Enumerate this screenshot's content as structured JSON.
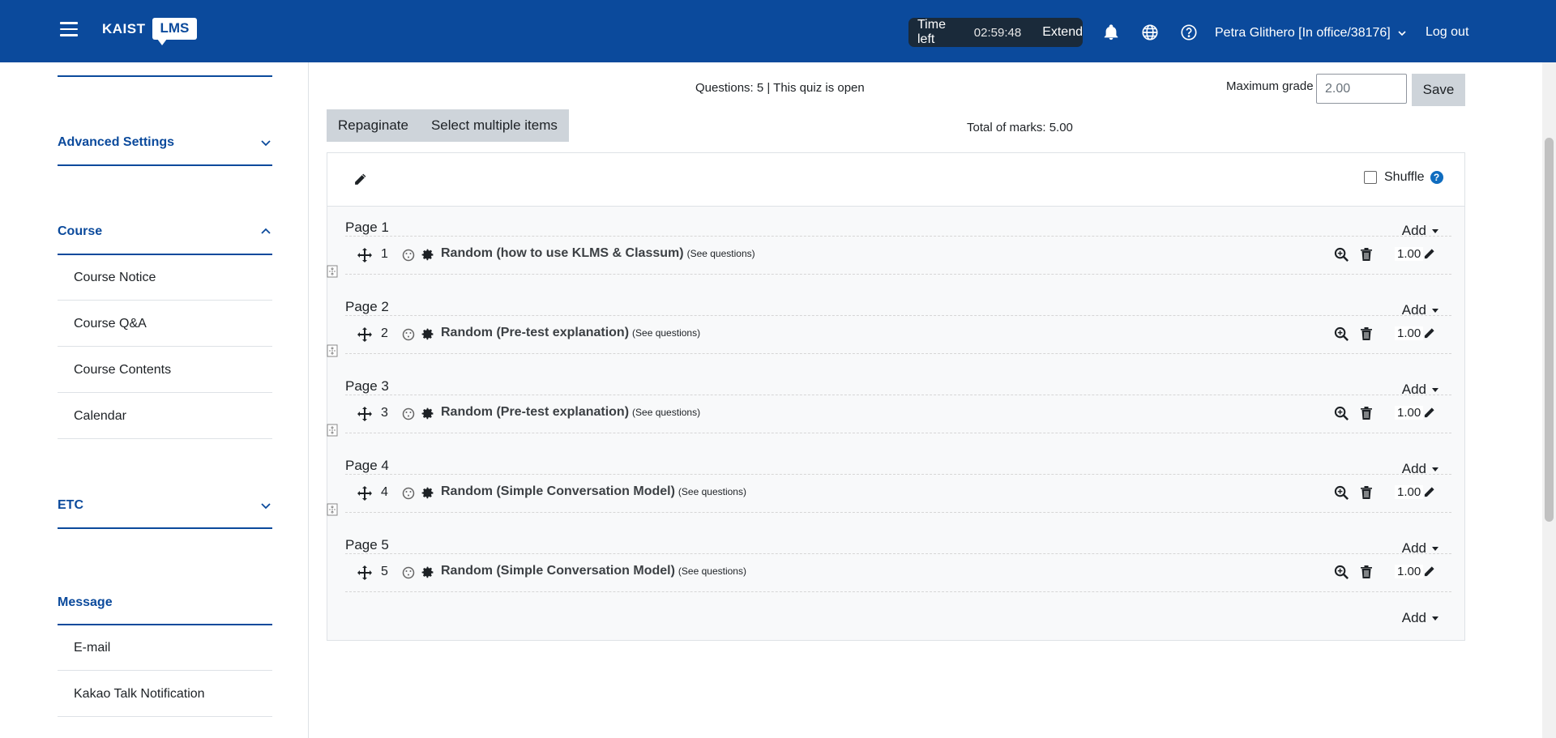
{
  "navbar": {
    "logo_text": "KAIST",
    "logo_badge": "LMS",
    "timer_label": "Time left",
    "timer_value": "02:59:48",
    "extend_label": "Extend",
    "user_name": "Petra Glithero [In office/38176]",
    "logout_label": "Log out",
    "icons": [
      "menu-icon",
      "bell-icon",
      "globe-icon",
      "help-icon",
      "chevron-down-icon"
    ]
  },
  "sidebar": {
    "sections": [
      {
        "label": "Advanced Settings",
        "expanded": false
      },
      {
        "label": "Course",
        "expanded": true,
        "items": [
          "Course Notice",
          "Course Q&A",
          "Course Contents",
          "Calendar"
        ]
      },
      {
        "label": "ETC",
        "expanded": false
      },
      {
        "label": "Message",
        "items": [
          "E-mail",
          "Kakao Talk Notification"
        ]
      }
    ]
  },
  "main": {
    "questions_info": "Questions: 5 | This quiz is open",
    "max_grade_label": "Maximum grade",
    "max_grade_value": "2.00",
    "save_label": "Save",
    "repaginate_label": "Repaginate",
    "select_multiple_label": "Select multiple items",
    "total_marks": "Total of marks: 5.00",
    "shuffle_label": "Shuffle",
    "shuffle_checked": false,
    "add_label": "Add",
    "pages": [
      {
        "title": "Page 1",
        "number": "1",
        "name": "Random (how to use KLMS & Classum)",
        "see": "(See questions)",
        "mark": "1.00"
      },
      {
        "title": "Page 2",
        "number": "2",
        "name": "Random (Pre-test explanation)",
        "see": "(See questions)",
        "mark": "1.00"
      },
      {
        "title": "Page 3",
        "number": "3",
        "name": "Random (Pre-test explanation)",
        "see": "(See questions)",
        "mark": "1.00"
      },
      {
        "title": "Page 4",
        "number": "4",
        "name": "Random (Simple Conversation Model)",
        "see": "(See questions)",
        "mark": "1.00"
      },
      {
        "title": "Page 5",
        "number": "5",
        "name": "Random (Simple Conversation Model)",
        "see": "(See questions)",
        "mark": "1.00"
      }
    ]
  },
  "colors": {
    "brand": "#0b4a9c",
    "timer_bg": "#1a2a3a",
    "button_gray": "#ced4da",
    "help_blue": "#0f6cbf"
  }
}
